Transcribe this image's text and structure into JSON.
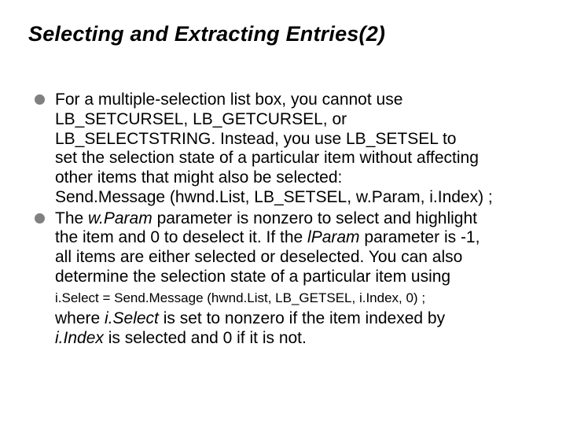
{
  "slide": {
    "title": "Selecting and Extracting Entries(2)",
    "bullet1": {
      "l1": "For a multiple-selection list box, you cannot use",
      "l2": "LB_SETCURSEL, LB_GETCURSEL, or",
      "l3": "LB_SELECTSTRING. Instead, you use LB_SETSEL to",
      "l4": "set the selection state of a particular item without affecting",
      "l5": "other items that might also be selected:",
      "l6": "Send.Message (hwnd.List, LB_SETSEL, w.Param, i.Index) ;"
    },
    "bullet2": {
      "p1a": "The ",
      "p1b": "w.Param",
      "p1c": " parameter is nonzero to select and highlight",
      "l2a": "the item and 0 to deselect it. If the ",
      "l2b": "lParam",
      "l2c": " parameter is -1,",
      "l3": "all items are either selected or deselected. You can also",
      "l4": "determine the selection state of a particular item using",
      "sub": "i.Select = Send.Message (hwnd.List, LB_GETSEL, i.Index, 0) ;",
      "c1a": "where ",
      "c1b": "i.Select",
      "c1c": " is set to nonzero if the item indexed by",
      "c2a": "i.Index",
      "c2b": " is selected and 0 if it is not."
    }
  }
}
